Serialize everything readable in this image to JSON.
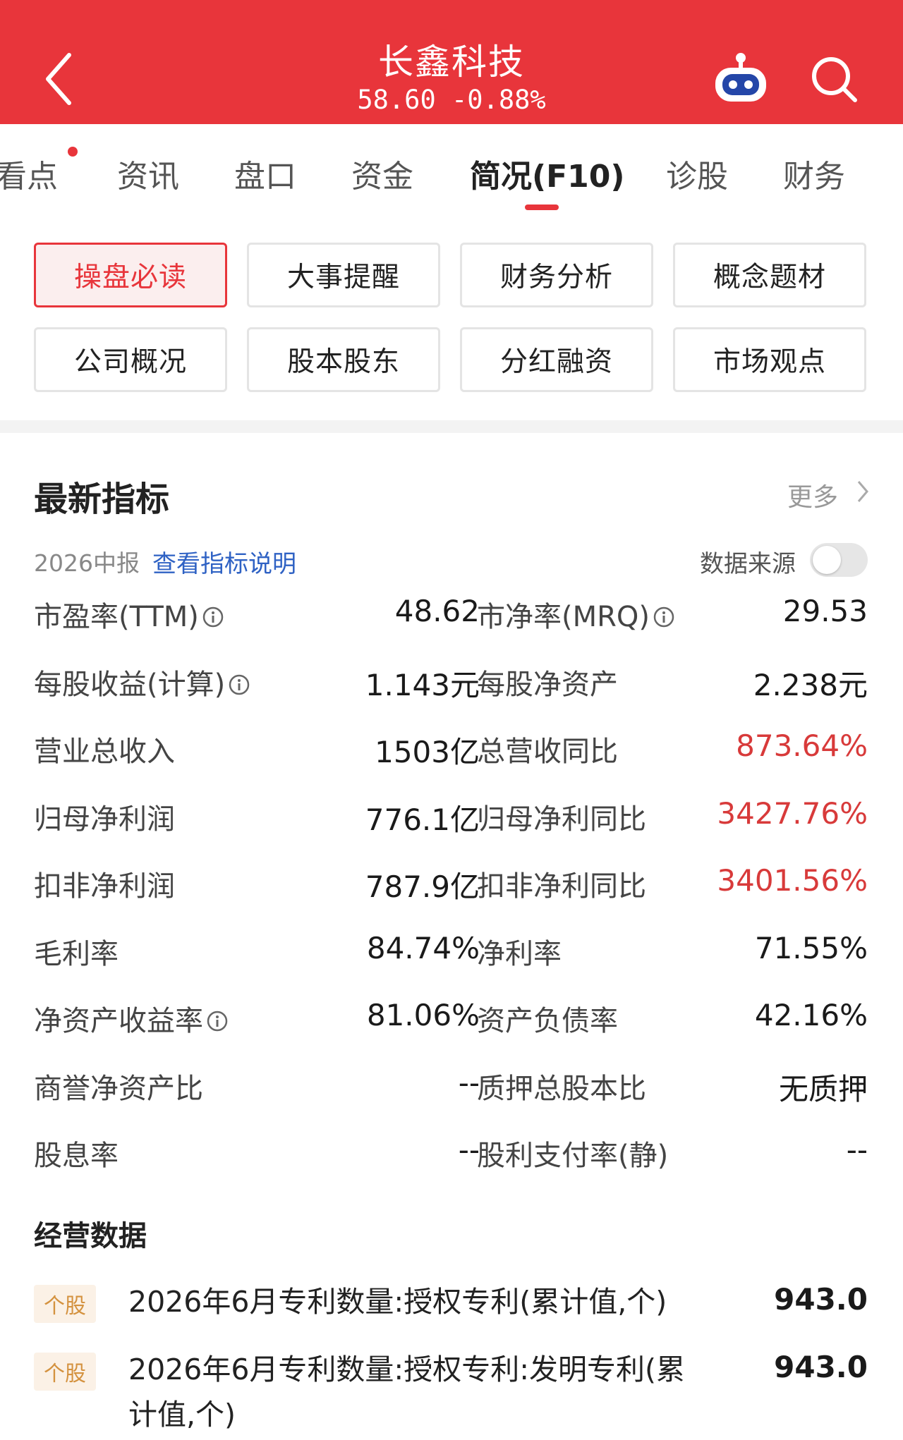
{
  "header": {
    "title": "长鑫科技",
    "quote": "58.60 -0.88%"
  },
  "tabs": [
    "看点",
    "资讯",
    "盘口",
    "资金",
    "简况(F10)",
    "诊股",
    "财务"
  ],
  "active_tab": "简况(F10)",
  "shortcuts": [
    "操盘必读",
    "大事提醒",
    "财务分析",
    "概念题材",
    "公司概况",
    "股本股东",
    "分红融资",
    "市场观点"
  ],
  "indicators": {
    "title": "最新指标",
    "more": "更多",
    "period": "2026中报",
    "explain_link": "查看指标说明",
    "source_label": "数据来源",
    "source_toggle": "off",
    "rows": [
      {
        "l_label": "市盈率(TTM)",
        "l_info": true,
        "l_value": "48.62",
        "r_label": "市净率(MRQ)",
        "r_info": true,
        "r_value": "29.53",
        "r_red": false
      },
      {
        "l_label": "每股收益(计算)",
        "l_info": true,
        "l_value": "1.143元",
        "r_label": "每股净资产",
        "r_info": false,
        "r_value": "2.238元",
        "r_red": false
      },
      {
        "l_label": "营业总收入",
        "l_info": false,
        "l_value": "1503亿",
        "r_label": "总营收同比",
        "r_info": false,
        "r_value": "873.64%",
        "r_red": true
      },
      {
        "l_label": "归母净利润",
        "l_info": false,
        "l_value": "776.1亿",
        "r_label": "归母净利同比",
        "r_info": false,
        "r_value": "3427.76%",
        "r_red": true
      },
      {
        "l_label": "扣非净利润",
        "l_info": false,
        "l_value": "787.9亿",
        "r_label": "扣非净利同比",
        "r_info": false,
        "r_value": "3401.56%",
        "r_red": true
      },
      {
        "l_label": "毛利率",
        "l_info": false,
        "l_value": "84.74%",
        "r_label": "净利率",
        "r_info": false,
        "r_value": "71.55%",
        "r_red": false
      },
      {
        "l_label": "净资产收益率",
        "l_info": true,
        "l_value": "81.06%",
        "r_label": "资产负债率",
        "r_info": false,
        "r_value": "42.16%",
        "r_red": false
      },
      {
        "l_label": "商誉净资产比",
        "l_info": false,
        "l_value": "--",
        "r_label": "质押总股本比",
        "r_info": false,
        "r_value": "无质押",
        "r_red": false
      },
      {
        "l_label": "股息率",
        "l_info": false,
        "l_value": "--",
        "r_label": "股利支付率(静)",
        "r_info": false,
        "r_value": "--",
        "r_red": false
      }
    ]
  },
  "operations": {
    "title": "经营数据",
    "items": [
      {
        "tag": "个股",
        "text": "2026年6月专利数量:授权专利(累计值,个)",
        "value": "943.0"
      },
      {
        "tag": "个股",
        "text": "2026年6月专利数量:授权专利:发明专利(累计值,个)",
        "value": "943.0"
      }
    ]
  },
  "colors": {
    "brand_red": "#e8353b",
    "link_blue": "#2f62c4",
    "value_red": "#d83a3a"
  }
}
